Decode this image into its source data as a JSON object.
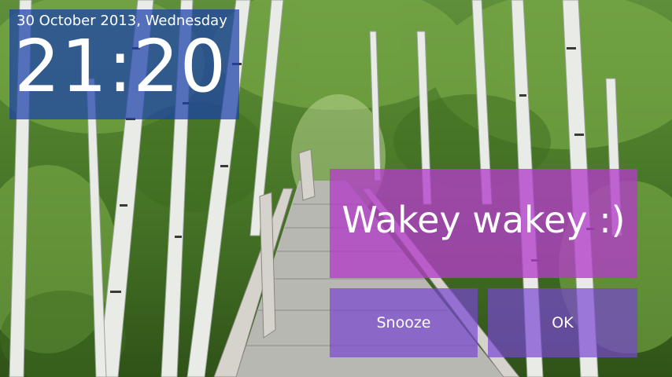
{
  "clock": {
    "date": "30 October 2013, Wednesday",
    "time": "21:20"
  },
  "alarm": {
    "message": "Wakey wakey :)",
    "snooze_label": "Snooze",
    "ok_label": "OK"
  },
  "colors": {
    "clock_panel": "#1a40aa",
    "message_panel": "#b23cc8",
    "buttons": "#7846d2",
    "text": "#ffffff"
  }
}
